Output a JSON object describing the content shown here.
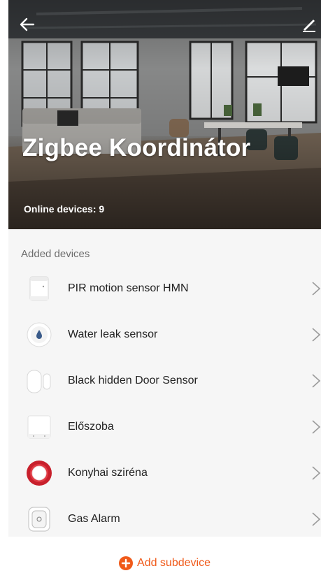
{
  "header": {
    "title": "Zigbee Koordinátor",
    "online_devices": "Online devices: 9"
  },
  "list": {
    "section_label": "Added devices",
    "devices": [
      {
        "name": "PIR motion sensor HMN",
        "icon": "pir-sensor-icon"
      },
      {
        "name": "Water leak sensor",
        "icon": "water-leak-sensor-icon"
      },
      {
        "name": "Black hidden Door Sensor",
        "icon": "door-sensor-icon"
      },
      {
        "name": "Előszoba",
        "icon": "hub-device-icon"
      },
      {
        "name": "Konyhai sziréna",
        "icon": "siren-icon"
      },
      {
        "name": "Gas Alarm",
        "icon": "gas-alarm-icon"
      }
    ]
  },
  "footer": {
    "add_label": "Add subdevice",
    "accent_color": "#f05a1a"
  }
}
